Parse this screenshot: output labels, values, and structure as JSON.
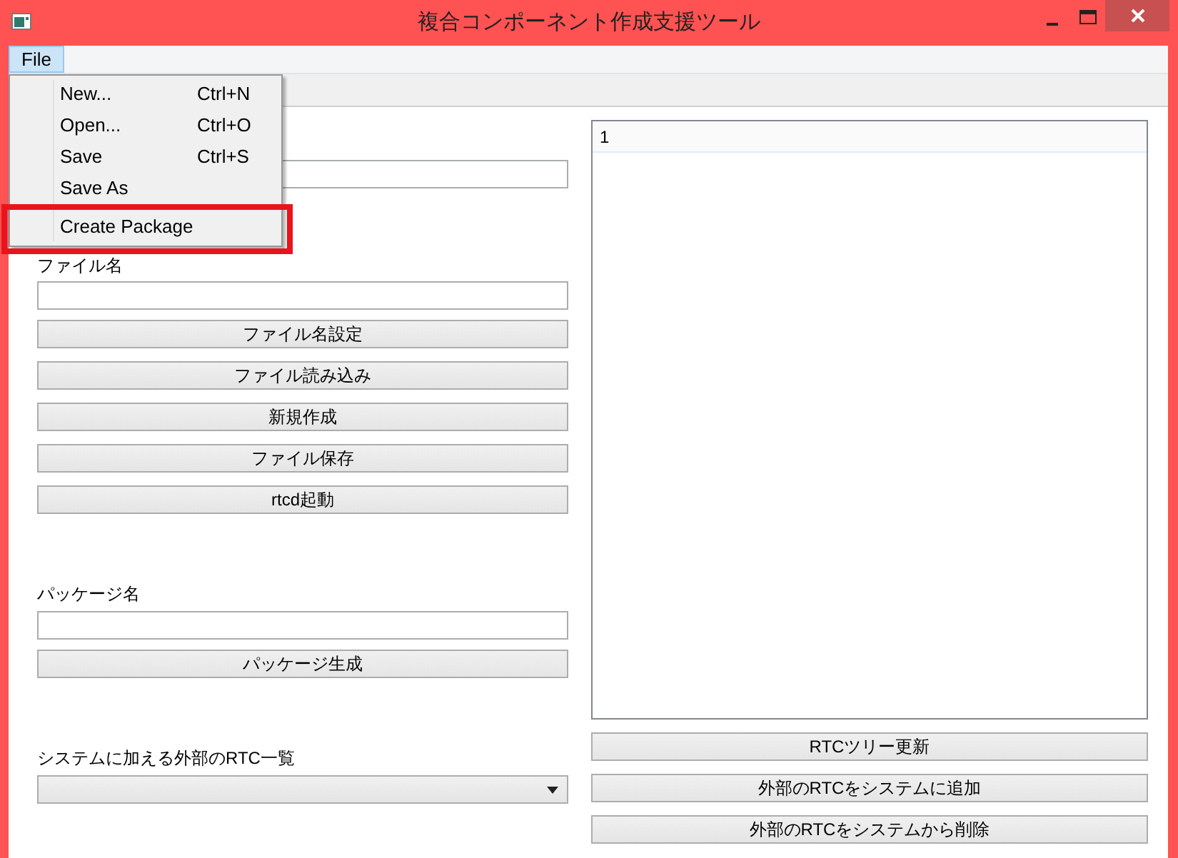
{
  "window": {
    "title": "複合コンポーネント作成支援ツール"
  },
  "menu_bar": [
    {
      "label": "File",
      "selected": true
    }
  ],
  "file_menu": {
    "items": [
      {
        "label": "New...",
        "shortcut": "Ctrl+N",
        "highlighted": false
      },
      {
        "label": "Open...",
        "shortcut": "Ctrl+O",
        "highlighted": false
      },
      {
        "label": "Save",
        "shortcut": "Ctrl+S",
        "highlighted": false
      },
      {
        "label": "Save As",
        "highlighted": false
      },
      {
        "label": "Create Package",
        "highlighted": true
      }
    ]
  },
  "left_panel": {
    "file_name_label": "ファイル名",
    "file_buttons": [
      "ファイル名設定",
      "ファイル読み込み",
      "新規作成",
      "ファイル保存",
      "rtcd起動"
    ],
    "package_label": "パッケージ名",
    "package_button": "パッケージ生成",
    "external_rtc_label": "システムに加える外部のRTC一覧"
  },
  "rtc_tree": {
    "rows": [
      "1"
    ]
  },
  "rtc_buttons": [
    "RTCツリー更新",
    "外部のRTCをシステムに追加",
    "外部のRTCをシステムから削除"
  ]
}
